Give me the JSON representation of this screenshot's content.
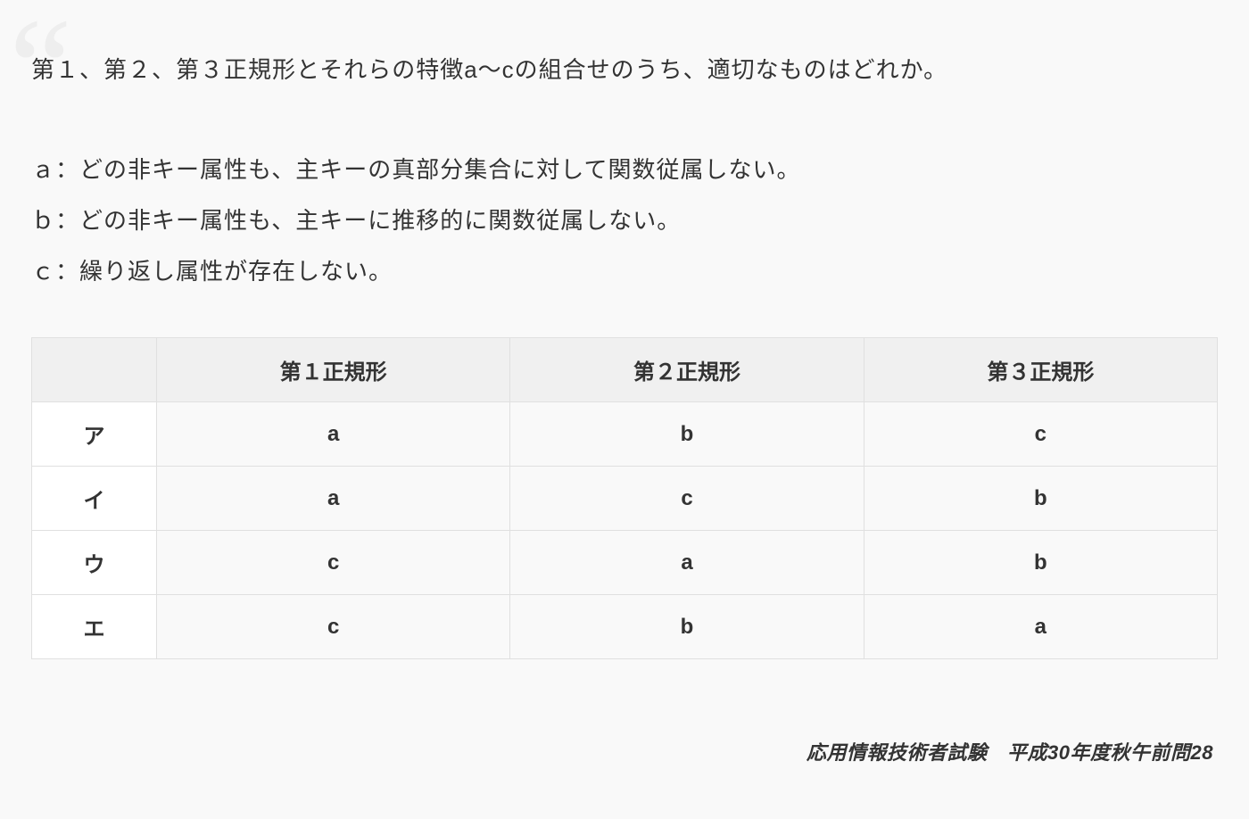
{
  "question": "第１、第２、第３正規形とそれらの特徴a～cの組合せのうち、適切なものはどれか。",
  "definitions": {
    "a": "ａ：どの非キー属性も、主キーの真部分集合に対して関数従属しない。",
    "b": "ｂ：どの非キー属性も、主キーに推移的に関数従属しない。",
    "c": "ｃ：繰り返し属性が存在しない。"
  },
  "table": {
    "headers": [
      "",
      "第１正規形",
      "第２正規形",
      "第３正規形"
    ],
    "rows": [
      {
        "label": "ア",
        "cells": [
          "a",
          "b",
          "c"
        ]
      },
      {
        "label": "イ",
        "cells": [
          "a",
          "c",
          "b"
        ]
      },
      {
        "label": "ウ",
        "cells": [
          "c",
          "a",
          "b"
        ]
      },
      {
        "label": "エ",
        "cells": [
          "c",
          "b",
          "a"
        ]
      }
    ]
  },
  "citation": "応用情報技術者試験　平成30年度秋午前問28"
}
